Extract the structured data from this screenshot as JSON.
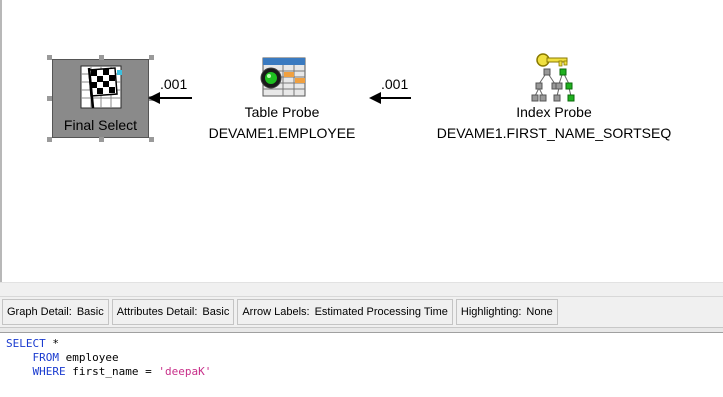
{
  "graph": {
    "nodes": [
      {
        "title": "Final Select",
        "subtitle": "",
        "icon": "checkered-flag-icon"
      },
      {
        "title": "Table Probe",
        "subtitle": "DEVAME1.EMPLOYEE",
        "icon": "table-probe-icon"
      },
      {
        "title": "Index Probe",
        "subtitle": "DEVAME1.FIRST_NAME_SORTSEQ",
        "icon": "index-key-tree-icon"
      }
    ],
    "arrows": [
      {
        "label": ".001"
      },
      {
        "label": ".001"
      }
    ]
  },
  "status_bar": {
    "graph_detail": {
      "label": "Graph Detail:",
      "value": "Basic"
    },
    "attributes_detail": {
      "label": "Attributes Detail:",
      "value": "Basic"
    },
    "arrow_labels": {
      "label": "Arrow Labels:",
      "value": "Estimated Processing Time"
    },
    "highlighting": {
      "label": "Highlighting:",
      "value": "None"
    }
  },
  "sql": {
    "line1_kw": "SELECT",
    "line1_rest": " *",
    "line2_kw": "FROM",
    "line2_rest": " employee",
    "line3_kw": "WHERE",
    "line3_rest": " first_name = ",
    "line3_str": "'deepaK'"
  },
  "colors": {
    "sql_keyword": "#1a3bcf",
    "sql_string": "#c8308a",
    "selected_node_fill": "#8a8a8a"
  }
}
